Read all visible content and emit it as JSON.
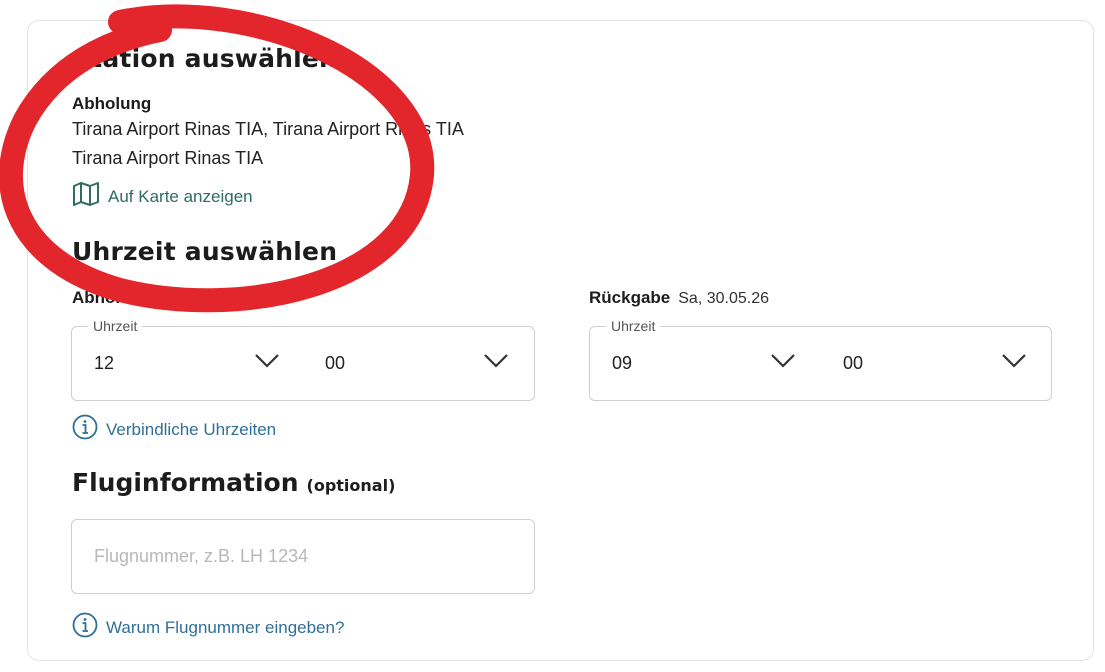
{
  "station": {
    "heading": "Station auswählen",
    "pickup_label": "Abholung",
    "address_line1": "Tirana Airport Rinas TIA, Tirana Airport Rinas TIA",
    "address_line2": "Tirana Airport Rinas TIA",
    "map_link": "Auf Karte anzeigen",
    "map_icon": "map-icon"
  },
  "time": {
    "heading": "Uhrzeit auswählen",
    "pickup": {
      "label": "Abholung",
      "legend": "Uhrzeit",
      "hour": "12",
      "minute": "00"
    },
    "return": {
      "label": "Rückgabe",
      "date": "Sa, 30.05.26",
      "legend": "Uhrzeit",
      "hour": "09",
      "minute": "00"
    },
    "info_link": "Verbindliche Uhrzeiten",
    "info_icon": "info-icon"
  },
  "flight": {
    "heading": "Fluginformation",
    "heading_suffix": "(optional)",
    "placeholder": "Flugnummer, z.B. LH 1234",
    "info_link": "Warum Flugnummer eingeben?"
  },
  "colors": {
    "annotation_red": "#e3262b",
    "link_green": "#2e6d5f",
    "link_blue": "#2f6f97"
  }
}
